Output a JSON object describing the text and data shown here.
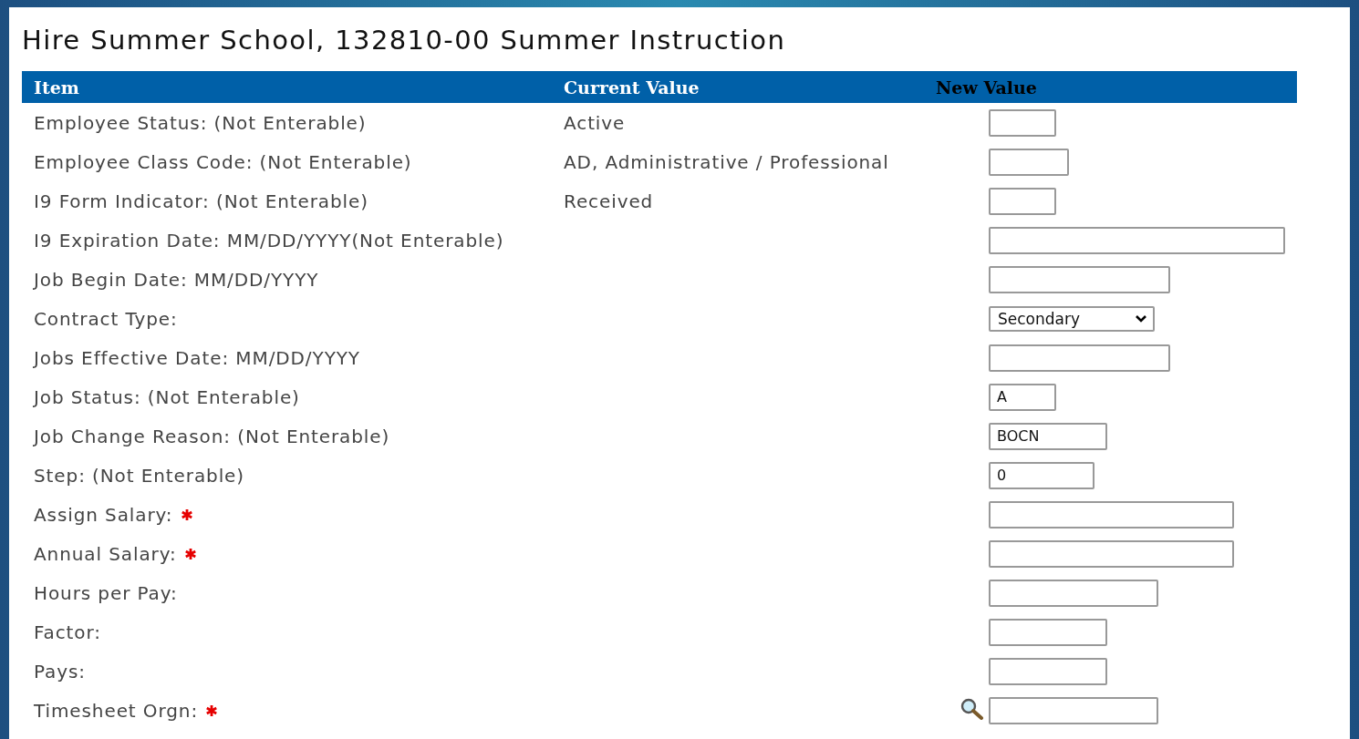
{
  "page_title": "Hire Summer School, 132810-00 Summer Instruction",
  "table": {
    "columns": [
      "Item",
      "Current Value",
      "New Value"
    ],
    "rows": [
      {
        "item": "Employee Status: (Not Enterable)",
        "required": false,
        "current": "Active",
        "field": {
          "kind": "text"
        }
      },
      {
        "item": "Employee Class Code: (Not Enterable)",
        "required": false,
        "current": "AD, Administrative / Professional",
        "field": {
          "kind": "text"
        }
      },
      {
        "item": "I9 Form Indicator: (Not Enterable)",
        "required": false,
        "current": "Received",
        "field": {
          "kind": "text"
        }
      },
      {
        "item": "I9 Expiration Date: MM/DD/YYYY(Not Enterable)",
        "required": false,
        "field": {
          "kind": "text"
        }
      },
      {
        "item": "Job Begin Date: MM/DD/YYYY",
        "required": false,
        "field": {
          "kind": "text"
        }
      },
      {
        "item": "Contract Type:",
        "required": false,
        "field": {
          "kind": "select",
          "value": "Secondary"
        }
      },
      {
        "item": "Jobs Effective Date: MM/DD/YYYY",
        "required": false,
        "field": {
          "kind": "text"
        }
      },
      {
        "item": "Job Status: (Not Enterable)",
        "required": false,
        "field": {
          "kind": "text",
          "value": "A"
        }
      },
      {
        "item": "Job Change Reason: (Not Enterable)",
        "required": false,
        "field": {
          "kind": "text",
          "value": "BOCN"
        }
      },
      {
        "item": "Step: (Not Enterable)",
        "required": false,
        "field": {
          "kind": "text",
          "value": "0"
        }
      },
      {
        "item": "Assign Salary:",
        "required": true,
        "field": {
          "kind": "text"
        }
      },
      {
        "item": "Annual Salary:",
        "required": true,
        "field": {
          "kind": "text"
        }
      },
      {
        "item": "Hours per Pay:",
        "required": false,
        "field": {
          "kind": "text"
        }
      },
      {
        "item": "Factor:",
        "required": false,
        "field": {
          "kind": "text"
        }
      },
      {
        "item": "Pays:",
        "required": false,
        "field": {
          "kind": "text"
        }
      },
      {
        "item": "Timesheet Orgn:",
        "required": true,
        "lookup": true,
        "field": {
          "kind": "text"
        }
      }
    ]
  }
}
